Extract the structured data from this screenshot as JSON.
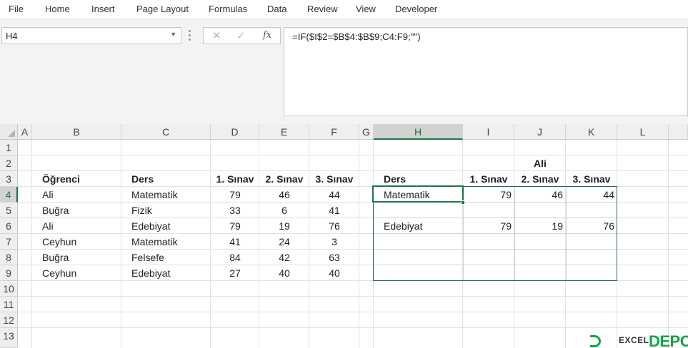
{
  "menu": [
    "File",
    "Home",
    "Insert",
    "Page Layout",
    "Formulas",
    "Data",
    "Review",
    "View",
    "Developer"
  ],
  "name_box": "H4",
  "formula_icons": {
    "cancel": "✕",
    "enter": "✓",
    "fx": "fx"
  },
  "formula": "=IF($I$2=$B$4:$B$9;C4:F9;\"\")",
  "columns": [
    "A",
    "B",
    "C",
    "D",
    "E",
    "F",
    "G",
    "H",
    "I",
    "J",
    "K",
    "L"
  ],
  "rows": [
    "1",
    "2",
    "3",
    "4",
    "5",
    "6",
    "7",
    "8",
    "9",
    "10",
    "11",
    "12",
    "13"
  ],
  "source_table": {
    "headers": [
      "Öğrenci",
      "Ders",
      "1. Sınav",
      "2. Sınav",
      "3. Sınav"
    ],
    "rows": [
      [
        "Ali",
        "Matematik",
        "79",
        "46",
        "44"
      ],
      [
        "Buğra",
        "Fizik",
        "33",
        "6",
        "41"
      ],
      [
        "Ali",
        "Edebiyat",
        "79",
        "19",
        "76"
      ],
      [
        "Ceyhun",
        "Matematik",
        "41",
        "24",
        "3"
      ],
      [
        "Buğra",
        "Felsefe",
        "84",
        "42",
        "63"
      ],
      [
        "Ceyhun",
        "Edebiyat",
        "27",
        "40",
        "40"
      ]
    ]
  },
  "lookup": {
    "key": "Ali",
    "headers": [
      "Ders",
      "1. Sınav",
      "2. Sınav",
      "3. Sınav"
    ],
    "rows": [
      [
        "Matematik",
        "79",
        "46",
        "44"
      ],
      [
        "",
        "",
        "",
        ""
      ],
      [
        "Edebiyat",
        "79",
        "19",
        "76"
      ],
      [
        "",
        "",
        "",
        ""
      ],
      [
        "",
        "",
        "",
        ""
      ],
      [
        "",
        "",
        "",
        ""
      ]
    ]
  },
  "watermark": {
    "text": "EXCEL",
    "brand": "DEPO",
    "color": "#16a34a"
  },
  "colors": {
    "accent": "#217346",
    "table_border": "#2f5f73"
  }
}
